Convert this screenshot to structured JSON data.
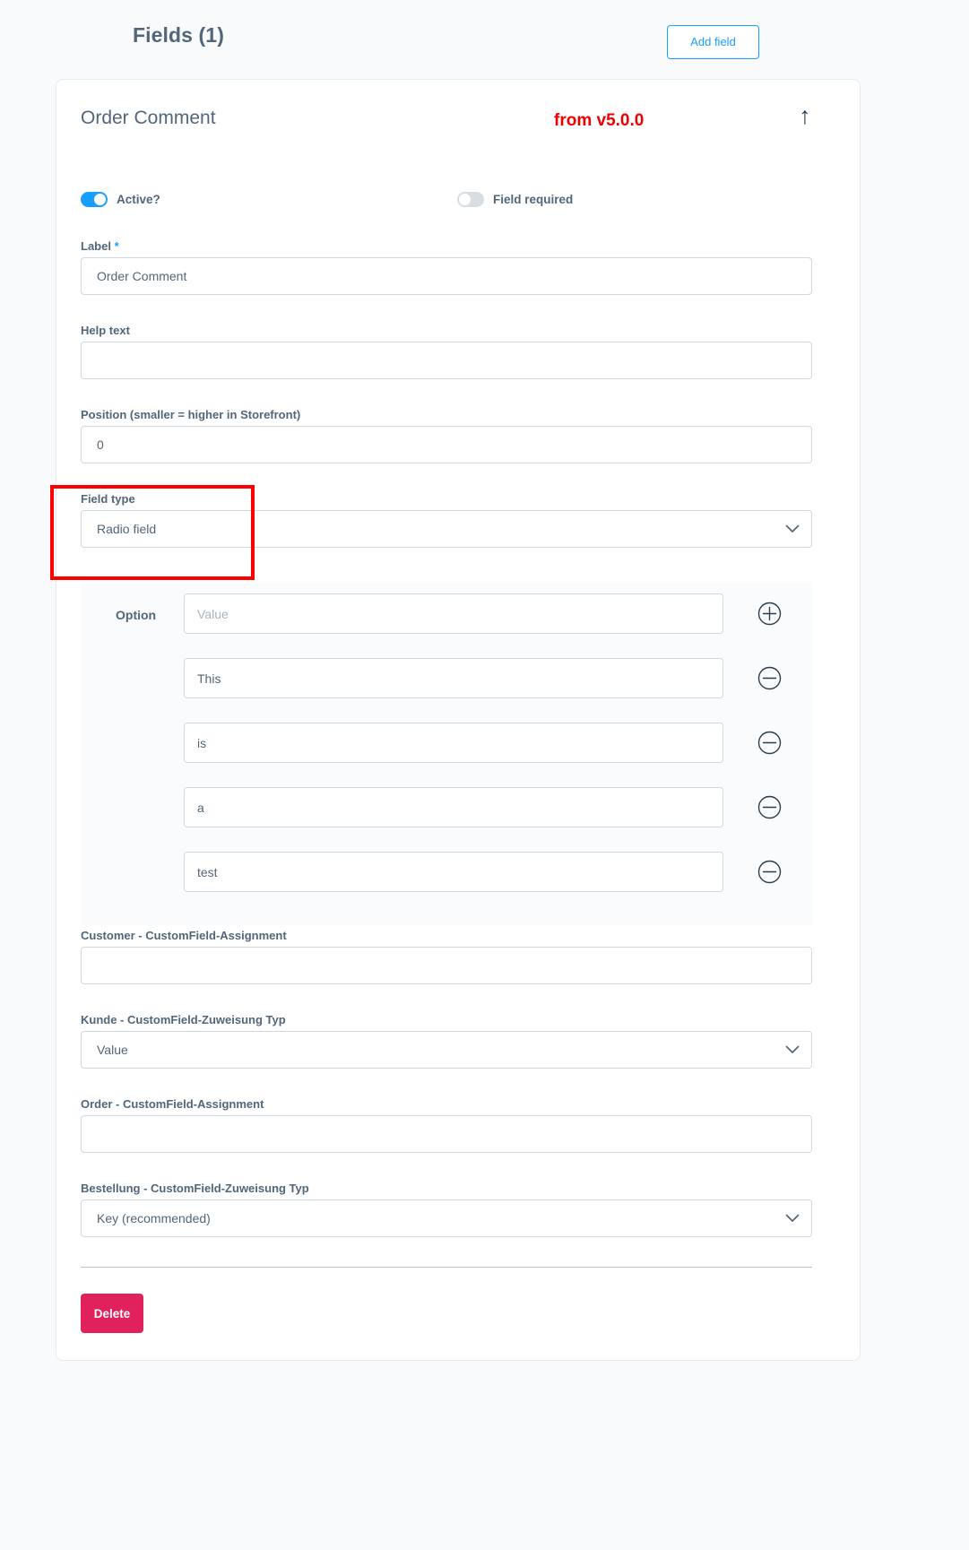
{
  "header": {
    "title": "Fields (1)",
    "add_field_label": "Add field"
  },
  "card": {
    "title": "Order Comment",
    "version_note": "from v5.0.0",
    "collapse_icon": "↑",
    "toggles": [
      {
        "label": "Active?",
        "state": "on"
      },
      {
        "label": "Field required",
        "state": "off"
      }
    ],
    "fields": {
      "label": {
        "label": "Label",
        "required_marker": "*",
        "value": "Order Comment"
      },
      "help_text": {
        "label": "Help text",
        "value": ""
      },
      "position": {
        "label": "Position (smaller = higher in Storefront)",
        "value": "0"
      },
      "field_type": {
        "label": "Field type",
        "value": "Radio field"
      },
      "customer_assignment": {
        "label": "Customer - CustomField-Assignment",
        "value": ""
      },
      "kunde_zuweisung_typ": {
        "label": "Kunde - CustomField-Zuweisung Typ",
        "value": "Value"
      },
      "order_assignment": {
        "label": "Order - CustomField-Assignment",
        "value": ""
      },
      "bestellung_zuweisung_typ": {
        "label": "Bestellung - CustomField-Zuweisung Typ",
        "value": "Key (recommended)"
      }
    },
    "options": {
      "label": "Option",
      "rows": [
        {
          "value": "",
          "placeholder": "Value",
          "action": "add"
        },
        {
          "value": "This",
          "placeholder": "",
          "action": "remove"
        },
        {
          "value": "is",
          "placeholder": "",
          "action": "remove"
        },
        {
          "value": "a",
          "placeholder": "",
          "action": "remove"
        },
        {
          "value": "test",
          "placeholder": "",
          "action": "remove"
        }
      ]
    },
    "delete_label": "Delete"
  },
  "colors": {
    "accent_blue": "#189eff",
    "danger_red": "#e1215b",
    "highlight_red": "#ff0000",
    "text_slate": "#52667a"
  }
}
